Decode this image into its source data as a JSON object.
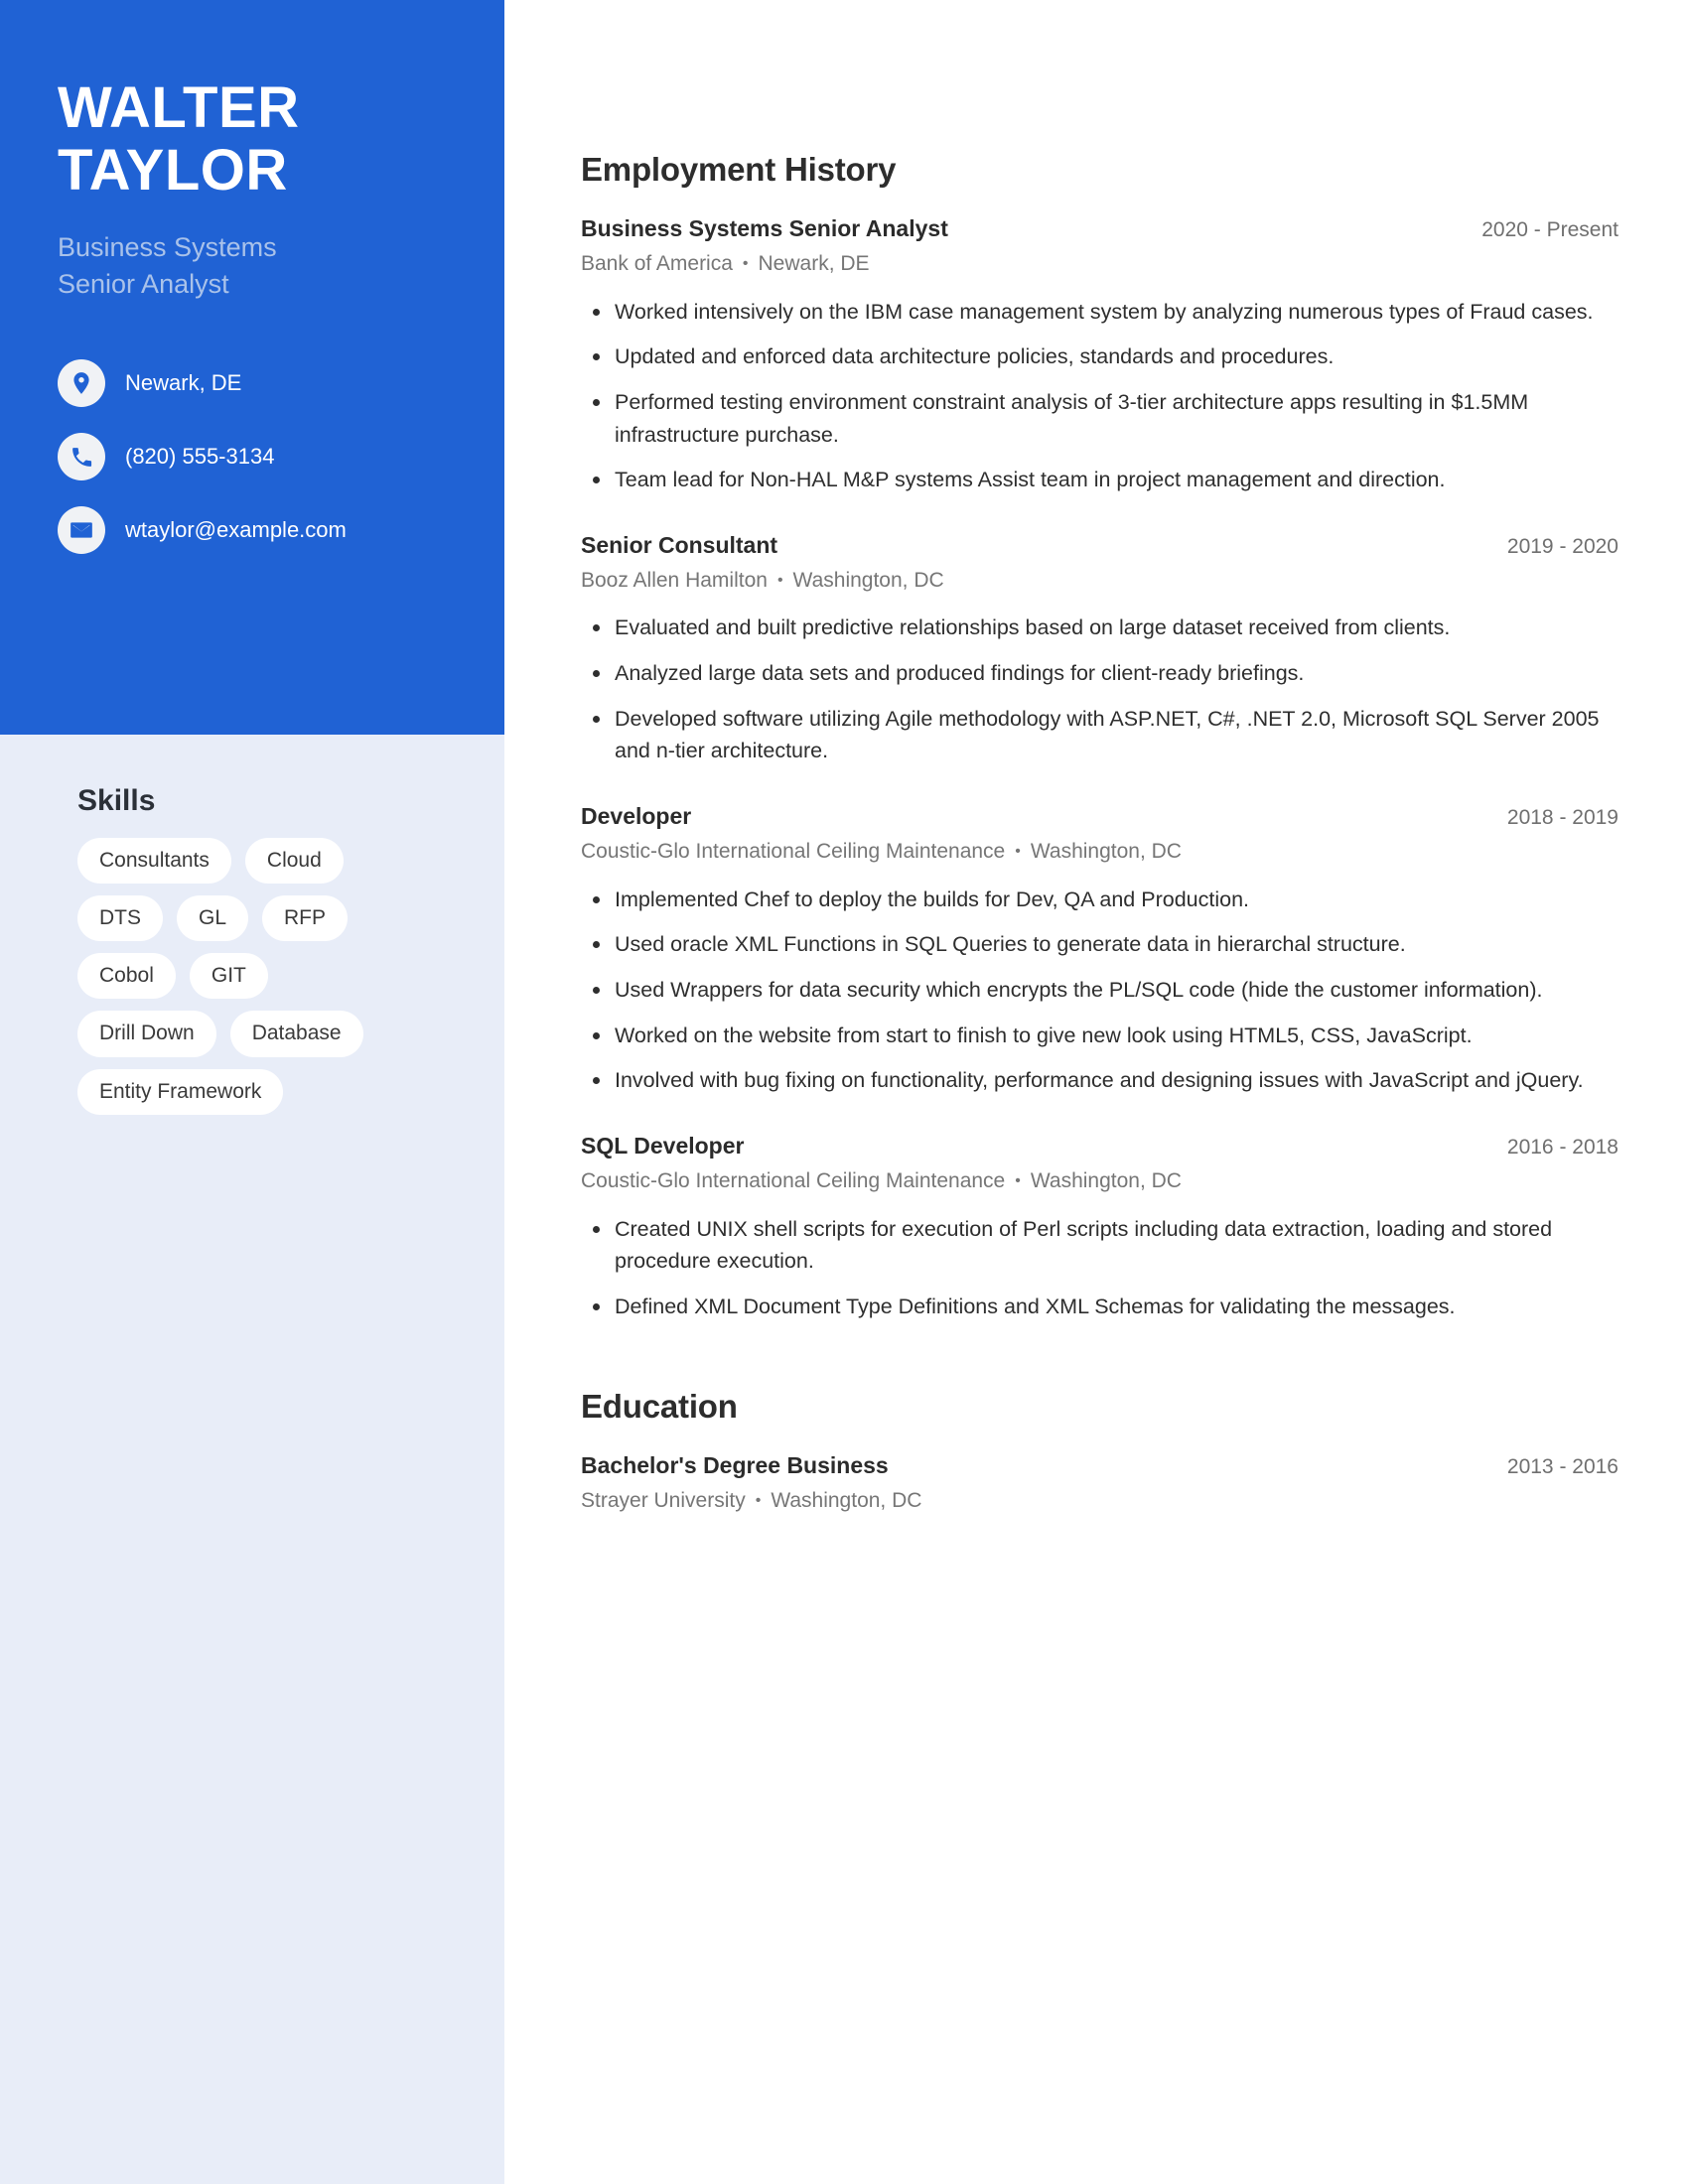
{
  "theme": {
    "accent_blue": "#2062d4",
    "sidebar_bg": "#e8edf8",
    "subtitle_blue": "#a9c2ea",
    "text_dark": "#2b2b2b",
    "text_gray": "#767676"
  },
  "sidebar": {
    "name_first": "WALTER",
    "name_last": "TAYLOR",
    "subtitle_line1": "Business Systems",
    "subtitle_line2": "Senior Analyst",
    "contacts": [
      {
        "icon": "location-pin-icon",
        "value": "Newark, DE"
      },
      {
        "icon": "phone-icon",
        "value": "(820) 555-3134"
      },
      {
        "icon": "email-envelope-icon",
        "value": "wtaylor@example.com"
      }
    ],
    "skills_heading": "Skills",
    "skills": [
      "Consultants",
      "Cloud",
      "DTS",
      "GL",
      "RFP",
      "Cobol",
      "GIT",
      "Drill Down",
      "Database",
      "Entity Framework"
    ]
  },
  "main": {
    "employment_heading": "Employment History",
    "education_heading": "Education",
    "separator": "•",
    "jobs": [
      {
        "title": "Business Systems Senior Analyst",
        "date": "2020 - Present",
        "company": "Bank of America",
        "location": "Newark, DE",
        "bullets": [
          "Worked intensively on the IBM case management system by analyzing numerous types of Fraud cases.",
          "Updated and enforced data architecture policies, standards and procedures.",
          "Performed testing environment constraint analysis of 3-tier architecture apps resulting in $1.5MM infrastructure purchase.",
          "Team lead for Non-HAL M&P systems Assist team in project management and direction."
        ]
      },
      {
        "title": "Senior Consultant",
        "date": "2019 - 2020",
        "company": "Booz Allen Hamilton",
        "location": "Washington, DC",
        "bullets": [
          "Evaluated and built predictive relationships based on large dataset received from clients.",
          "Analyzed large data sets and produced findings for client-ready briefings.",
          "Developed software utilizing Agile methodology with ASP.NET, C#, .NET 2.0, Microsoft SQL Server 2005 and n-tier architecture."
        ]
      },
      {
        "title": "Developer",
        "date": "2018 - 2019",
        "company": "Coustic-Glo International Ceiling Maintenance",
        "location": "Washington, DC",
        "bullets": [
          "Implemented Chef to deploy the builds for Dev, QA and Production.",
          "Used oracle XML Functions in SQL Queries to generate data in hierarchal structure.",
          "Used Wrappers for data security which encrypts the PL/SQL code (hide the customer information).",
          "Worked on the website from start to finish to give new look using HTML5, CSS, JavaScript.",
          "Involved with bug fixing on functionality, performance and designing issues with JavaScript and jQuery."
        ]
      },
      {
        "title": "SQL Developer",
        "date": "2016 - 2018",
        "company": "Coustic-Glo International Ceiling Maintenance",
        "location": "Washington, DC",
        "bullets": [
          "Created UNIX shell scripts for execution of Perl scripts including data extraction, loading and stored procedure execution.",
          "Defined XML Document Type Definitions and XML Schemas for validating the messages."
        ]
      }
    ],
    "education": [
      {
        "title": "Bachelor's Degree Business",
        "date": "2013 - 2016",
        "school": "Strayer University",
        "location": "Washington, DC"
      }
    ]
  }
}
